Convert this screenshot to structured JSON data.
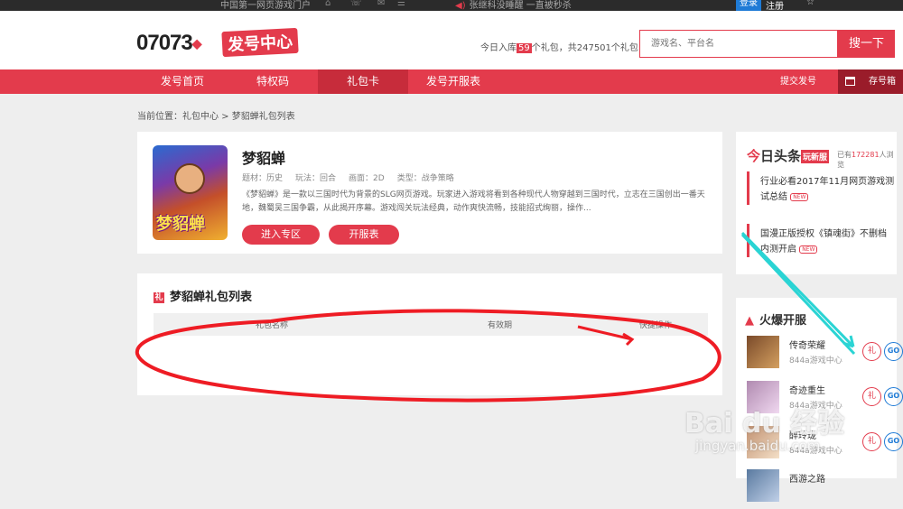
{
  "topbar": {
    "portal": "中国第一网页游戏门户",
    "announcement": "张继科没睡醒 一直被秒杀",
    "login": "登录",
    "register": "注册"
  },
  "header": {
    "logo_number": "07073",
    "logo_badge": "发号中心",
    "stats_prefix": "今日入库",
    "stats_today": "59",
    "stats_mid": "个礼包，共",
    "stats_total": "247501",
    "stats_suffix": "个礼包",
    "search_placeholder": "游戏名、平台名",
    "search_button": "搜一下"
  },
  "nav": {
    "items": [
      "发号首页",
      "特权码",
      "礼包卡",
      "发号开服表"
    ],
    "submit": "提交发号",
    "box": "存号箱"
  },
  "breadcrumb": "当前位置：礼包中心 > 梦貂蝉礼包列表",
  "game": {
    "cover_text": "梦貂蝉",
    "name": "梦貂蝉",
    "theme": "题材：历史",
    "play": "玩法：回合",
    "graphics": "画面：2D",
    "type": "类型：战争策略",
    "desc": "《梦貂蝉》是一款以三国时代为背景的SLG网页游戏。玩家进入游戏将看到各种现代人物穿越到三国时代，立志在三国创出一番天地，魏蜀吴三国争霸，从此揭开序幕。游戏闯关玩法经典，动作爽快流畅，技能招式绚丽，操作...",
    "btn_zone": "进入专区",
    "btn_server": "开服表"
  },
  "gift_list": {
    "title": "梦貂蝉礼包列表",
    "col_name": "礼包名称",
    "col_valid": "有效期",
    "col_action": "快捷操作"
  },
  "toutiao": {
    "title_a": "今",
    "title_b": "日头条",
    "tag": "玩新服",
    "browse_prefix": "已有",
    "browse_count": "172281",
    "browse_suffix": "人浏览",
    "news": [
      {
        "text": "行业必看2017年11月网页游戏测试总结",
        "badge": "NEW"
      },
      {
        "text": "国漫正版授权《镇魂街》不删档内测开启",
        "badge": "NEW"
      }
    ]
  },
  "hot": {
    "title": "火爆开服",
    "rows": [
      {
        "name": "传奇荣耀",
        "sub": "844a游戏中心",
        "gift": "礼",
        "go": "GO"
      },
      {
        "name": "奇迹重生",
        "sub": "844a游戏中心",
        "gift": "礼",
        "go": "GO"
      },
      {
        "name": "醉玲珑",
        "sub": "844a游戏中心",
        "gift": "礼",
        "go": "GO"
      },
      {
        "name": "西游之路",
        "sub": "",
        "gift": "",
        "go": ""
      }
    ]
  },
  "watermark": {
    "brand": "Bai du 经验",
    "url": "jingyan.baidu.com"
  },
  "colors": {
    "accent": "#e33b4c",
    "link_blue": "#1f7bd6",
    "arrow_cyan": "#2ad4d4"
  }
}
